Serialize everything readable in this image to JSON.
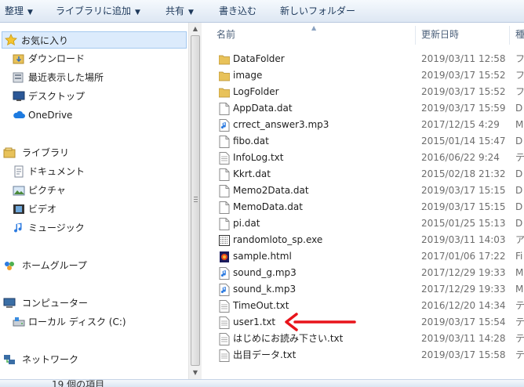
{
  "toolbar": {
    "organize": "整理",
    "add_to_library": "ライブラリに追加",
    "share": "共有",
    "burn": "書き込む",
    "new_folder": "新しいフォルダー"
  },
  "nav": {
    "favorites": "お気に入り",
    "downloads": "ダウンロード",
    "recent_places": "最近表示した場所",
    "desktop": "デスクトップ",
    "onedrive": "OneDrive",
    "libraries": "ライブラリ",
    "documents": "ドキュメント",
    "pictures": "ピクチャ",
    "videos": "ビデオ",
    "music": "ミュージック",
    "homegroup": "ホームグループ",
    "computer": "コンピューター",
    "local_disk": "ローカル ディスク (C:)",
    "network": "ネットワーク"
  },
  "columns": {
    "name": "名前",
    "date_modified": "更新日時",
    "type": "種"
  },
  "files": [
    {
      "name": "DataFolder",
      "date": "2019/03/11 12:58",
      "type": "フ",
      "icon": "folder-icon"
    },
    {
      "name": "image",
      "date": "2019/03/17 15:52",
      "type": "フ",
      "icon": "folder-icon"
    },
    {
      "name": "LogFolder",
      "date": "2019/03/17 15:52",
      "type": "フ",
      "icon": "folder-icon"
    },
    {
      "name": "AppData.dat",
      "date": "2019/03/17 15:59",
      "type": "D",
      "icon": "file-icon"
    },
    {
      "name": "crrect_answer3.mp3",
      "date": "2017/12/15 4:29",
      "type": "M",
      "icon": "audio-file-icon"
    },
    {
      "name": "fibo.dat",
      "date": "2015/01/14 15:47",
      "type": "D",
      "icon": "file-icon"
    },
    {
      "name": "InfoLog.txt",
      "date": "2016/06/22 9:24",
      "type": "テ",
      "icon": "text-file-icon"
    },
    {
      "name": "Kkrt.dat",
      "date": "2015/02/18 21:32",
      "type": "D",
      "icon": "file-icon"
    },
    {
      "name": "Memo2Data.dat",
      "date": "2019/03/17 15:15",
      "type": "D",
      "icon": "file-icon"
    },
    {
      "name": "MemoData.dat",
      "date": "2019/03/17 15:15",
      "type": "D",
      "icon": "file-icon"
    },
    {
      "name": "pi.dat",
      "date": "2015/01/25 15:13",
      "type": "D",
      "icon": "file-icon"
    },
    {
      "name": "randomloto_sp.exe",
      "date": "2019/03/11 14:03",
      "type": "ア",
      "icon": "exe-file-icon"
    },
    {
      "name": "sample.html",
      "date": "2017/01/06 17:22",
      "type": "Fi",
      "icon": "html-file-icon"
    },
    {
      "name": "sound_g.mp3",
      "date": "2017/12/29 19:33",
      "type": "M",
      "icon": "audio-file-icon"
    },
    {
      "name": "sound_k.mp3",
      "date": "2017/12/29 19:33",
      "type": "M",
      "icon": "audio-file-icon"
    },
    {
      "name": "TimeOut.txt",
      "date": "2016/12/20 14:34",
      "type": "テ",
      "icon": "text-file-icon"
    },
    {
      "name": "user1.txt",
      "date": "2019/03/17 15:54",
      "type": "テ",
      "icon": "text-file-icon"
    },
    {
      "name": "はじめにお読み下さい.txt",
      "date": "2019/03/11 14:28",
      "type": "テ",
      "icon": "text-file-icon"
    },
    {
      "name": "出目データ.txt",
      "date": "2019/03/17 15:58",
      "type": "テ",
      "icon": "text-file-icon"
    }
  ],
  "status": {
    "item_count": "19 個の項目"
  },
  "colors": {
    "annotation_arrow": "#e8141b",
    "folder": "#e8c25a",
    "selection": "#dcebfc"
  }
}
